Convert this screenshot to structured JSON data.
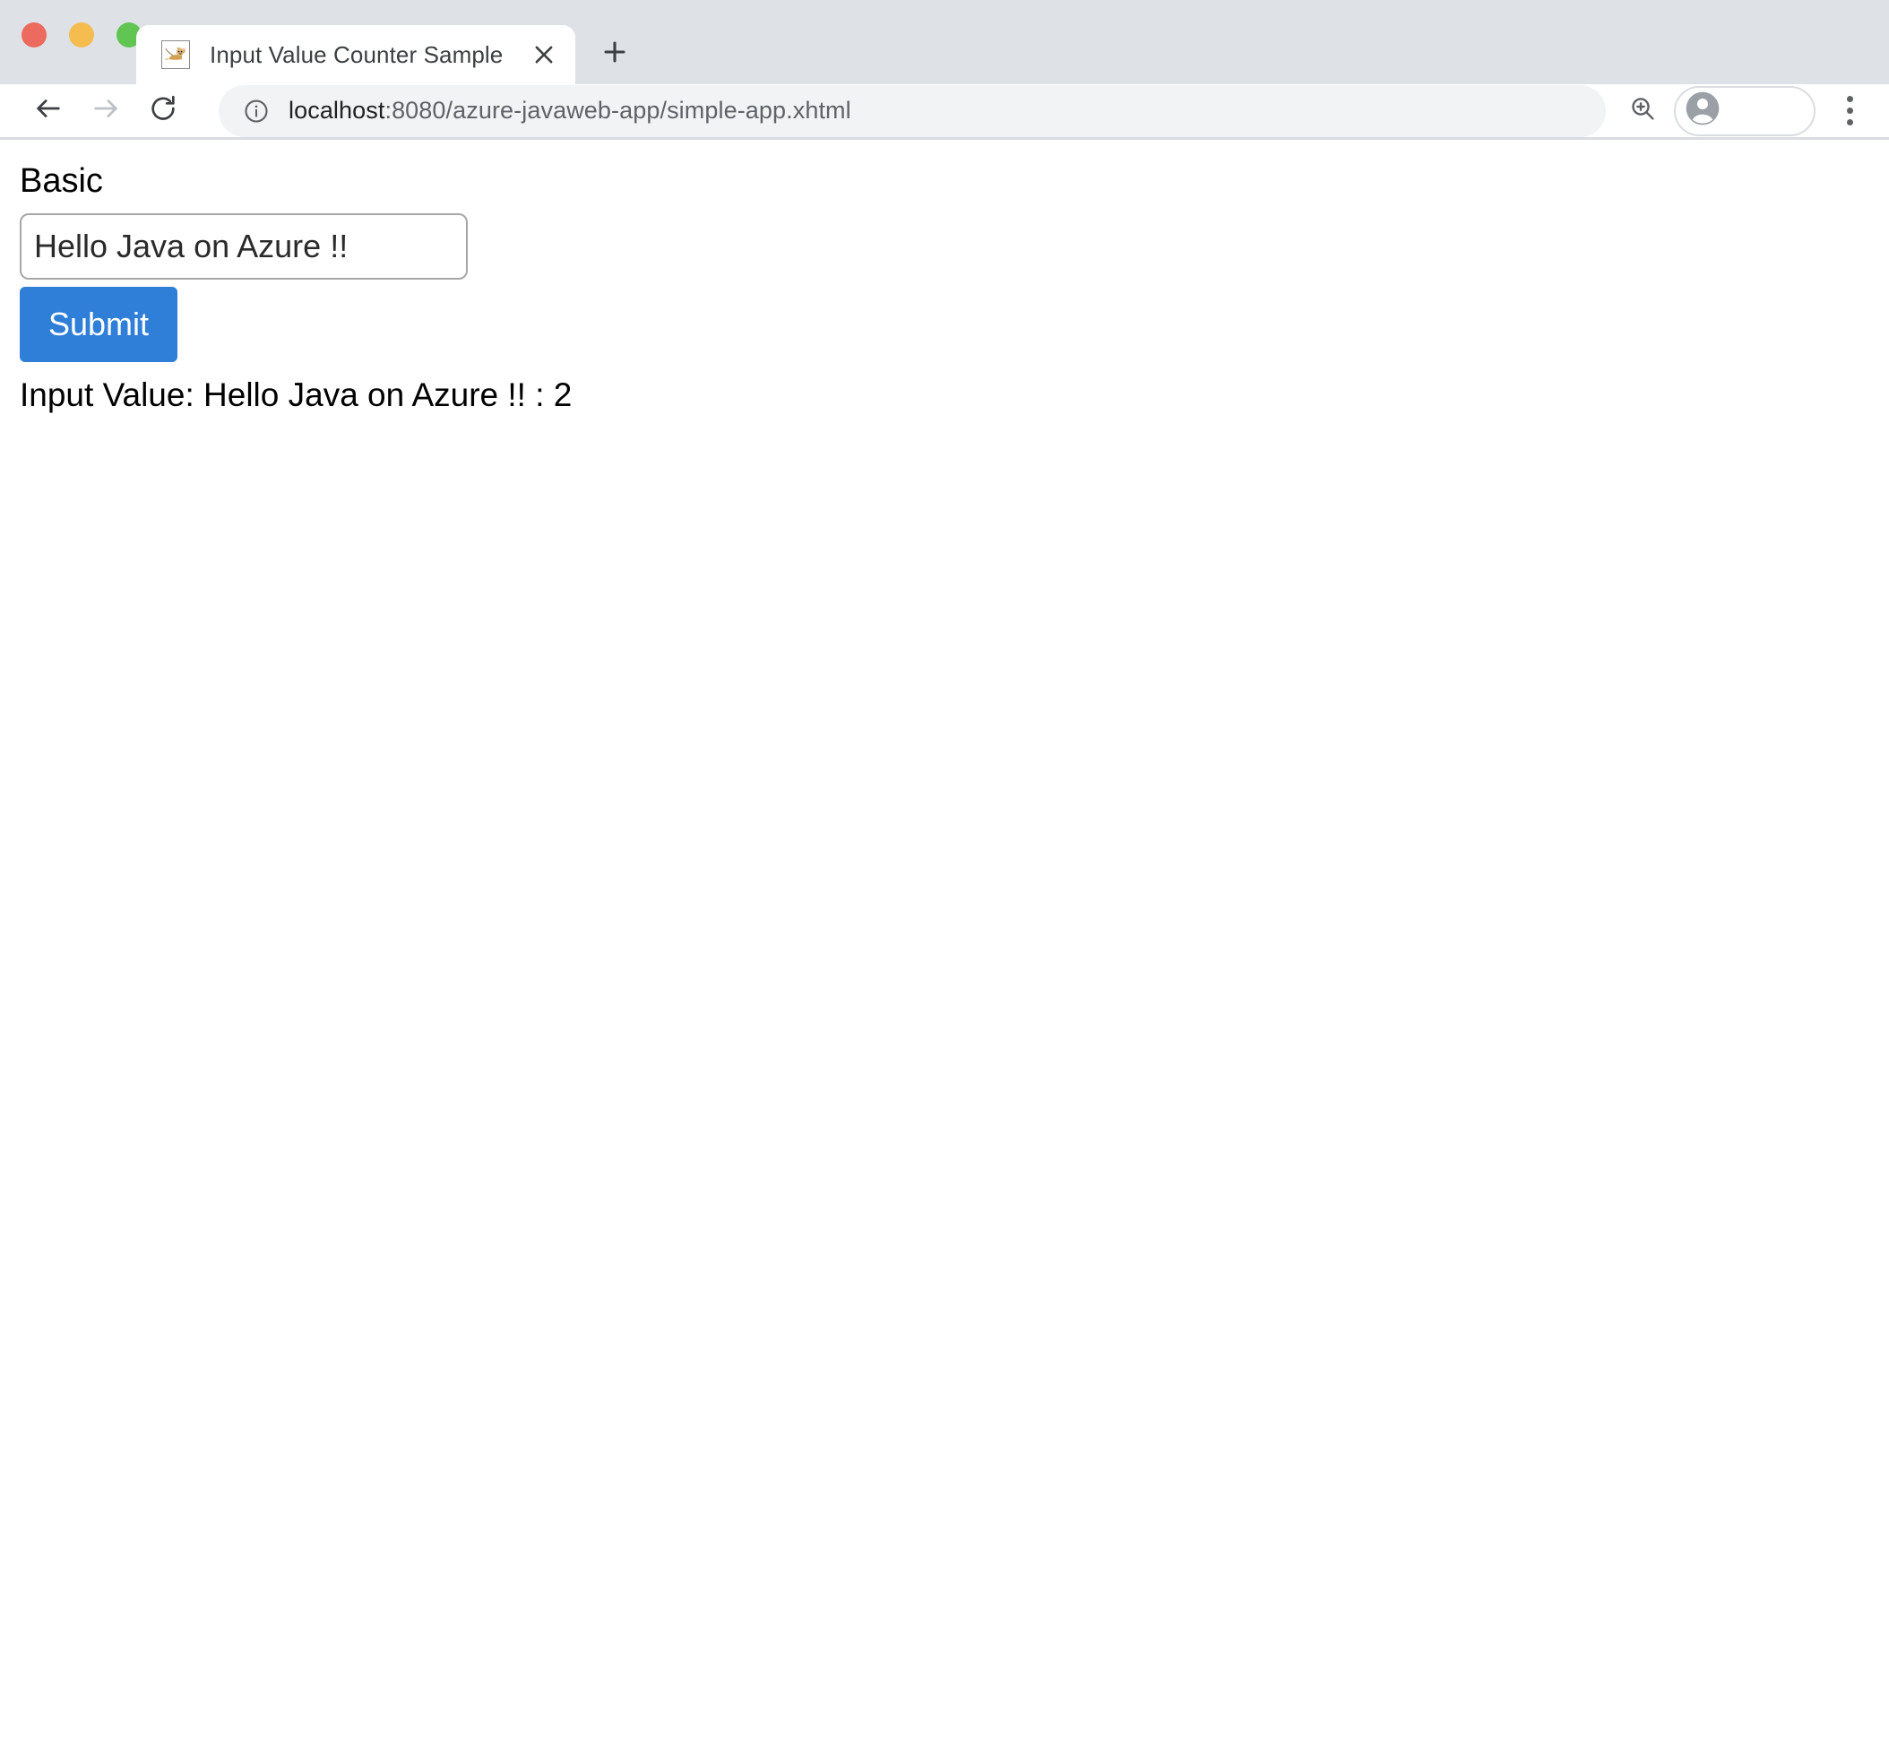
{
  "window": {
    "traffic_lights": [
      {
        "name": "close",
        "color": "#ed6a5e"
      },
      {
        "name": "minimize",
        "color": "#f5bd4f"
      },
      {
        "name": "maximize",
        "color": "#61c554"
      }
    ]
  },
  "tabstrip": {
    "tabs": [
      {
        "title": "Input Value Counter Sample",
        "favicon": "tomcat-icon",
        "close_icon": "close-icon",
        "active": true
      }
    ],
    "new_tab_icon": "plus-icon"
  },
  "toolbar": {
    "back_icon": "back-arrow-icon",
    "forward_icon": "forward-arrow-icon",
    "reload_icon": "reload-icon",
    "info_icon": "info-circle-icon",
    "zoom_icon": "zoom-in-icon",
    "profile_icon": "account-avatar-icon",
    "menu_icon": "three-dot-menu-icon",
    "url_host": "localhost",
    "url_rest": ":8080/azure-javaweb-app/simple-app.xhtml",
    "url_full": "localhost:8080/azure-javaweb-app/simple-app.xhtml"
  },
  "page": {
    "heading": "Basic",
    "input": {
      "value": "Hello Java on Azure !!",
      "placeholder": ""
    },
    "submit_label": "Submit",
    "result": "Input Value: Hello Java on Azure !! : 2",
    "result_prefix": "Input Value:",
    "result_value": "Hello Java on Azure !!",
    "result_count": "2"
  },
  "colors": {
    "accent": "#2f7ed8",
    "tabstrip_bg": "#dee1e6",
    "omnibox_bg": "#f1f3f4",
    "text_primary": "#202124",
    "text_secondary": "#5f6368"
  }
}
